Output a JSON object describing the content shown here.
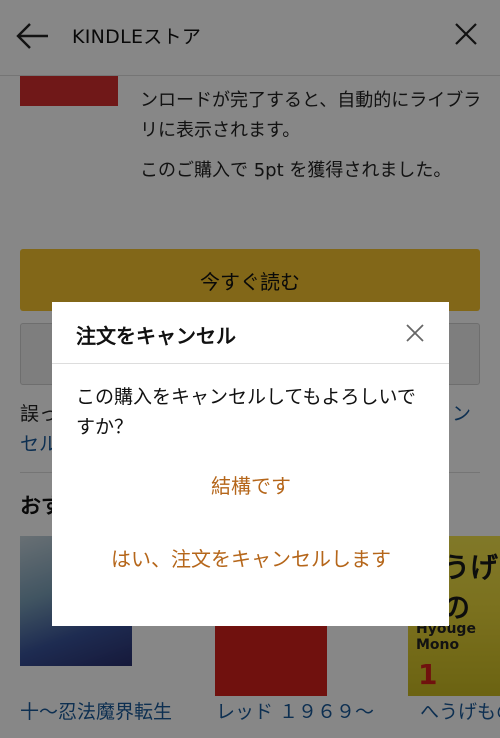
{
  "header": {
    "title": "KINDLEストア"
  },
  "purchase": {
    "download_message": "ンロードが完了すると、自動的にライブラリに表示されます。",
    "points_message": "このご購入で 5pt を獲得されました。",
    "read_now_label": "今すぐ読む"
  },
  "error_note": {
    "text_start": "誤っ",
    "link_end": "ン",
    "link_line2": "セル"
  },
  "recommendations": {
    "title": "おす",
    "books": [
      {
        "title": "十～忍法魔界転生"
      },
      {
        "title": "レッド １９６９～"
      },
      {
        "title": "へうげもの"
      }
    ],
    "cover3": {
      "art_title": "へうげもの",
      "subtitle": "Hyouge Mono",
      "volume": "1"
    }
  },
  "dialog": {
    "title": "注文をキャンセル",
    "body": "この購入をキャンセルしてもよろしいですか？",
    "option_keep": "結構です",
    "option_cancel": "はい、注文をキャンセルします"
  },
  "colors": {
    "read_button": "#f5c22e",
    "option_text": "#b5661a",
    "link": "#1a5a9a",
    "overlay": "rgba(0,0,0,0.47)"
  },
  "icons": {
    "back": "back-arrow-icon",
    "close": "close-icon"
  }
}
